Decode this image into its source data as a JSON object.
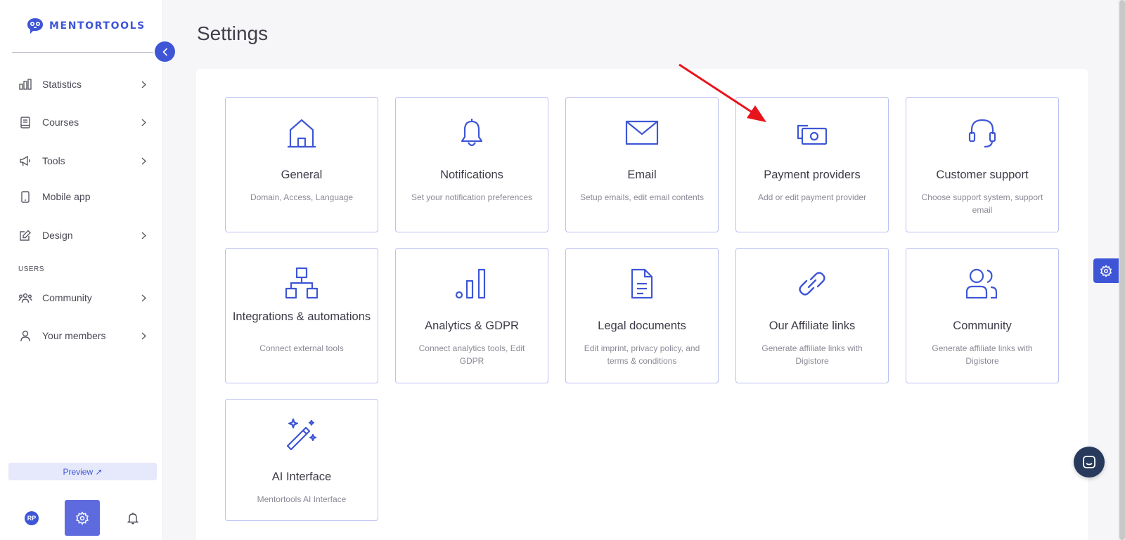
{
  "brand": {
    "name": "MENTORTOOLS",
    "accent": "#3e56d6"
  },
  "sidebar": {
    "items": [
      {
        "label": "Statistics",
        "icon": "chart-bar-icon",
        "has_chevron": true
      },
      {
        "label": "Courses",
        "icon": "book-icon",
        "has_chevron": true
      },
      {
        "label": "Tools",
        "icon": "megaphone-icon",
        "has_chevron": true
      },
      {
        "label": "Mobile app",
        "icon": "phone-icon",
        "has_chevron": false
      },
      {
        "label": "Design",
        "icon": "edit-icon",
        "has_chevron": true
      }
    ],
    "section_label": "USERS",
    "user_items": [
      {
        "label": "Community",
        "icon": "users-icon",
        "has_chevron": true
      },
      {
        "label": "Your members",
        "icon": "user-icon",
        "has_chevron": true
      }
    ],
    "preview_label": "Preview ↗",
    "avatar_initials": "RP"
  },
  "main": {
    "title": "Settings",
    "cards": [
      {
        "title": "General",
        "description": "Domain, Access, Language",
        "icon": "home-icon"
      },
      {
        "title": "Notifications",
        "description": "Set your notification preferences",
        "icon": "bell-icon"
      },
      {
        "title": "Email",
        "description": "Setup emails, edit email contents",
        "icon": "mail-icon"
      },
      {
        "title": "Payment providers",
        "description": "Add or edit payment provider",
        "icon": "money-icon"
      },
      {
        "title": "Customer support",
        "description": "Choose support system, support email",
        "icon": "headset-icon"
      },
      {
        "title": "Integrations & automations",
        "description": "Connect external tools",
        "icon": "hierarchy-icon"
      },
      {
        "title": "Analytics & GDPR",
        "description": "Connect analytics tools, Edit GDPR",
        "icon": "analytics-icon"
      },
      {
        "title": "Legal documents",
        "description": "Edit imprint, privacy policy, and terms & conditions",
        "icon": "document-icon"
      },
      {
        "title": "Our Affiliate links",
        "description": "Generate affiliate links with Digistore",
        "icon": "link-icon"
      },
      {
        "title": "Community",
        "description": "Generate affiliate links with Digistore",
        "icon": "users-icon"
      },
      {
        "title": "AI Interface",
        "description": "Mentortools AI Interface",
        "icon": "magic-wand-icon"
      }
    ]
  },
  "annotation": {
    "color": "#e8141c"
  }
}
